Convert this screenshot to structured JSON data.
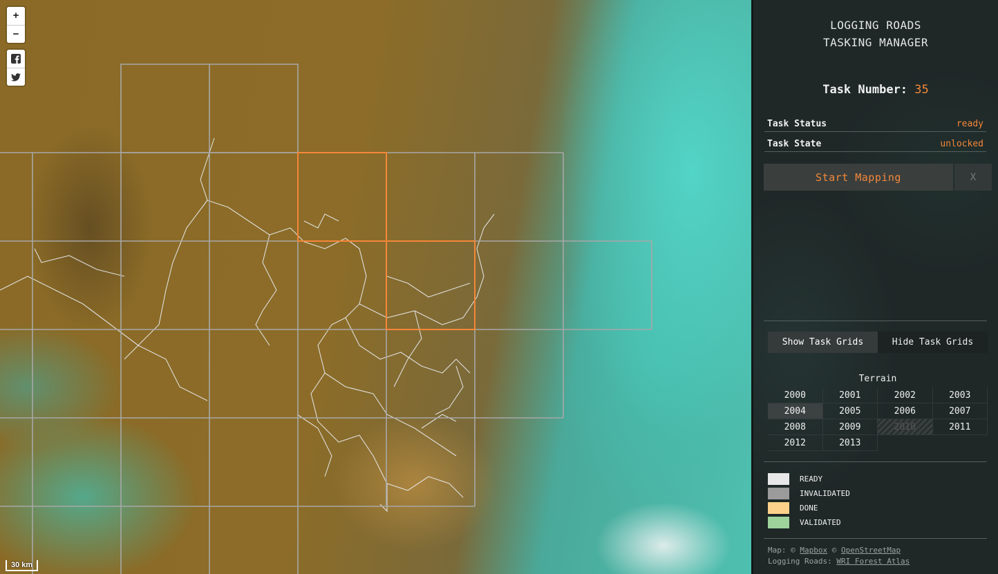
{
  "map": {
    "zoom_in_label": "+",
    "zoom_out_label": "−",
    "share_icons": [
      "facebook-icon",
      "twitter-icon"
    ],
    "scale_label": "30 km",
    "task_grid_color": "#aaaaaa",
    "selected_task_color": "#f5873a"
  },
  "sidebar": {
    "title_line1": "LOGGING ROADS",
    "title_line2": "TASKING MANAGER",
    "task_number_label": "Task Number:",
    "task_number": "35",
    "status_label": "Task Status",
    "status_value": "ready",
    "state_label": "Task State",
    "state_value": "unlocked",
    "start_button": "Start Mapping",
    "close_button": "X",
    "show_grids": "Show Task Grids",
    "hide_grids": "Hide Task Grids",
    "terrain_title": "Terrain",
    "years": [
      "2000",
      "2001",
      "2002",
      "2003",
      "2004",
      "2005",
      "2006",
      "2007",
      "2008",
      "2009",
      "2010",
      "2011",
      "2012",
      "2013"
    ],
    "selected_year": "2004",
    "disabled_year": "2010",
    "legend": [
      {
        "label": "READY",
        "color": "#e8e8e8"
      },
      {
        "label": "INVALIDATED",
        "color": "#9b9b9b"
      },
      {
        "label": "DONE",
        "color": "#fdd189"
      },
      {
        "label": "VALIDATED",
        "color": "#9fd39c"
      }
    ],
    "attribution": {
      "map_prefix": "Map: ©",
      "mapbox": "Mapbox",
      "sep": "©",
      "osm": "OpenStreetMap",
      "roads_prefix": "Logging Roads:",
      "wri": "WRI Forest Atlas"
    },
    "accent_color": "#f5873a"
  }
}
